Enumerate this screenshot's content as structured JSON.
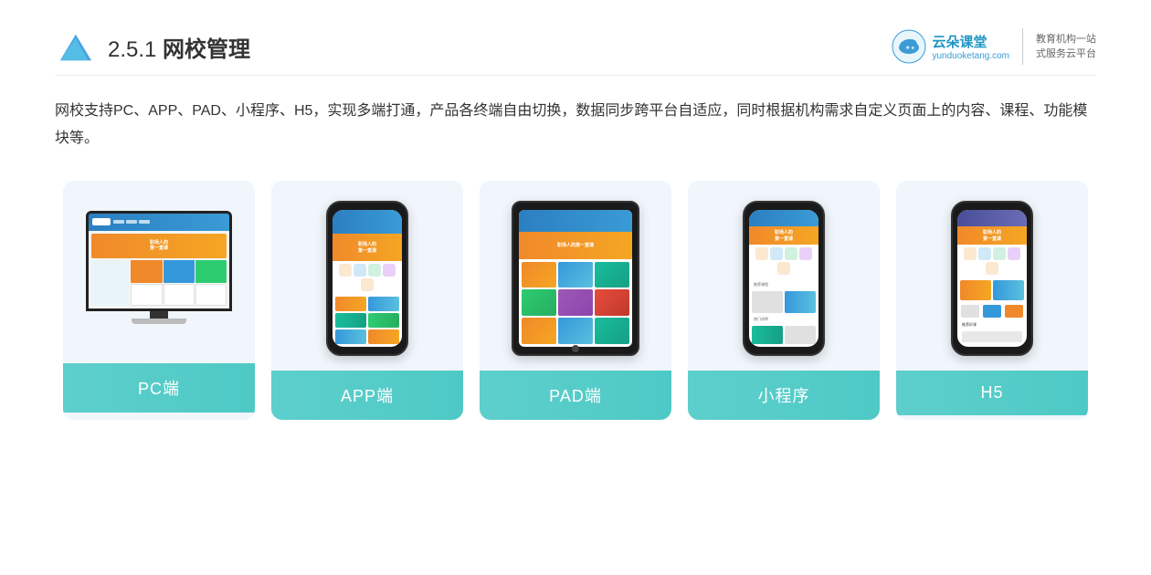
{
  "header": {
    "title_prefix": "2.5.1 ",
    "title_bold": "网校管理",
    "brand": {
      "name": "云朵课堂",
      "url_text": "yunduoketang.com",
      "slogan_line1": "教育机构一站",
      "slogan_line2": "式服务云平台"
    }
  },
  "description": {
    "text": "网校支持PC、APP、PAD、小程序、H5，实现多端打通，产品各终端自由切换，数据同步跨平台自适应，同时根据机构需求自定义页面上的内容、课程、功能模块等。"
  },
  "cards": [
    {
      "id": "pc",
      "label": "PC端",
      "device": "pc"
    },
    {
      "id": "app",
      "label": "APP端",
      "device": "phone"
    },
    {
      "id": "pad",
      "label": "PAD端",
      "device": "tablet"
    },
    {
      "id": "miniapp",
      "label": "小程序",
      "device": "phone"
    },
    {
      "id": "h5",
      "label": "H5",
      "device": "phone"
    }
  ],
  "colors": {
    "card_label_gradient_start": "#5dcfcc",
    "card_label_gradient_end": "#4ec9c5",
    "card_bg": "#eef5fb",
    "title_color": "#333",
    "description_color": "#333"
  }
}
